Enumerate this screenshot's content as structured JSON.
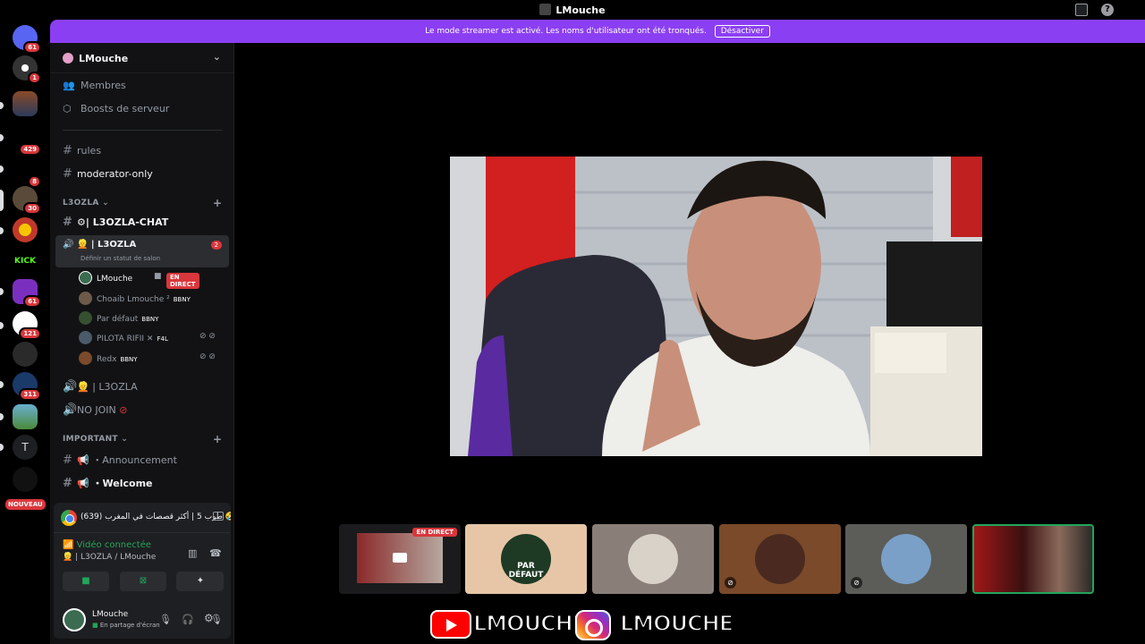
{
  "window": {
    "title": "LMouche"
  },
  "banner": {
    "text": "Le mode streamer est activé. Les noms d'utilisateur ont été tronqués.",
    "button": "Désactiver"
  },
  "servers": {
    "badges": [
      "61",
      "1",
      "429",
      "8",
      "30",
      "61",
      "121",
      "311"
    ],
    "kick_label": "KICK",
    "t_label": "T",
    "new_label": "NOUVEAU"
  },
  "sidebar": {
    "server_name": "LMouche",
    "nav": [
      {
        "label": "Membres",
        "icon": "members-icon"
      },
      {
        "label": "Boosts de serveur",
        "icon": "boost-icon"
      }
    ],
    "channels_top": [
      {
        "label": "rules",
        "bold": false
      },
      {
        "label": "moderator-only",
        "bold": false
      }
    ],
    "category_1": "L3OZLA",
    "chat_channel": "⚙| L3OZLA-CHAT",
    "active_voice": {
      "label": "| L3OZLA",
      "status": "Définir un statut de salon",
      "count": "2"
    },
    "voice_users": [
      {
        "name": "LMouche",
        "tag": "",
        "live": "EN DIRECT",
        "color": "#3b6b50"
      },
      {
        "name": "Choaib Lmouche ²",
        "tag": "BBNY",
        "live": "",
        "color": "#6d5a4a"
      },
      {
        "name": "Par défaut",
        "tag": "BBNY",
        "live": "",
        "color": "#355030"
      },
      {
        "name": "PILOTA RIFII ✕",
        "tag": "F4L",
        "live": "",
        "color": "#4b5a6a"
      },
      {
        "name": "Redx",
        "tag": "BBNY",
        "live": "",
        "color": "#7a4a2a"
      }
    ],
    "voice_2": "| L3OZLA",
    "voice_3": "NO JOIN",
    "category_2": "IMPORTANT",
    "announce": "・Announcement",
    "welcome": "・Welcome"
  },
  "panel": {
    "youtube_tab": "(639) طوب 5 | أكثر قصصات في المغرب 🤣🤣 - Y...",
    "video_connected": "Vidéo connectée",
    "channel_path": "| L3OZLA / LMouche",
    "user_name": "LMouche",
    "user_status": "En partage d'écran"
  },
  "stage": {
    "tiles": [
      {
        "label": "EN DIRECT",
        "bg": "#1b1b1d"
      },
      {
        "label": "PAR DÉFAUT",
        "bg": "#e6c6a7"
      },
      {
        "label": "",
        "bg": "#8a7f78"
      },
      {
        "label": "",
        "bg": "#7a4a2a"
      },
      {
        "label": "",
        "bg": "#5c5d58"
      },
      {
        "label": "",
        "bg": "#2a1a1a"
      }
    ]
  },
  "overlay": {
    "youtube": "LMOUCHE",
    "instagram": "LMOUCHE"
  },
  "colors": {
    "accent": "#8b3ff2",
    "live": "#da373c",
    "online": "#23a55a"
  }
}
